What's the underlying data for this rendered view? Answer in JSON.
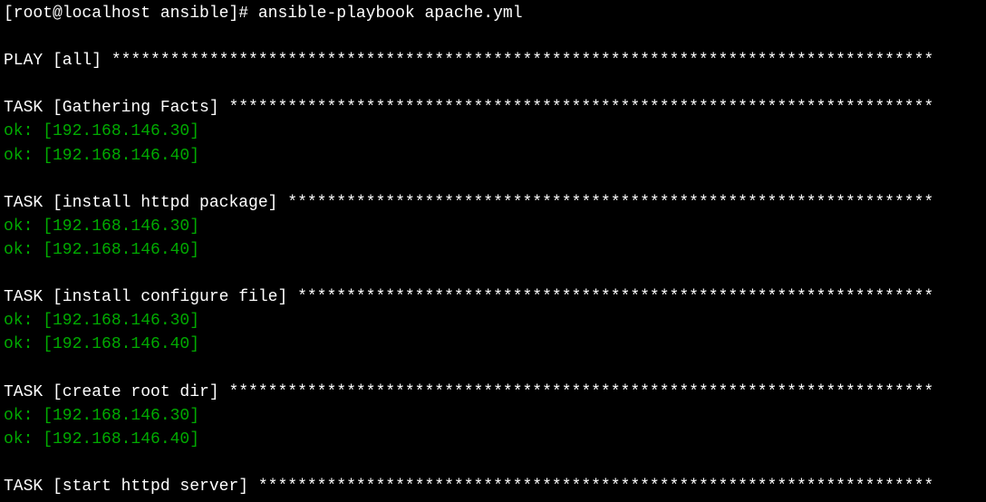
{
  "prompt": {
    "prefix": "[root@localhost ansible]# ",
    "command": "ansible-playbook apache.yml"
  },
  "play": {
    "header": "PLAY [all] ",
    "stars": "************************************************************************************"
  },
  "tasks": [
    {
      "header": "TASK [Gathering Facts] ",
      "stars": "************************************************************************",
      "results": [
        "ok: [192.168.146.30]",
        "ok: [192.168.146.40]"
      ]
    },
    {
      "header": "TASK [install httpd package] ",
      "stars": "******************************************************************",
      "results": [
        "ok: [192.168.146.30]",
        "ok: [192.168.146.40]"
      ]
    },
    {
      "header": "TASK [install configure file] ",
      "stars": "*****************************************************************",
      "results": [
        "ok: [192.168.146.30]",
        "ok: [192.168.146.40]"
      ]
    },
    {
      "header": "TASK [create root dir] ",
      "stars": "************************************************************************",
      "results": [
        "ok: [192.168.146.30]",
        "ok: [192.168.146.40]"
      ]
    },
    {
      "header": "TASK [start httpd server] ",
      "stars": "*********************************************************************",
      "results": []
    }
  ]
}
